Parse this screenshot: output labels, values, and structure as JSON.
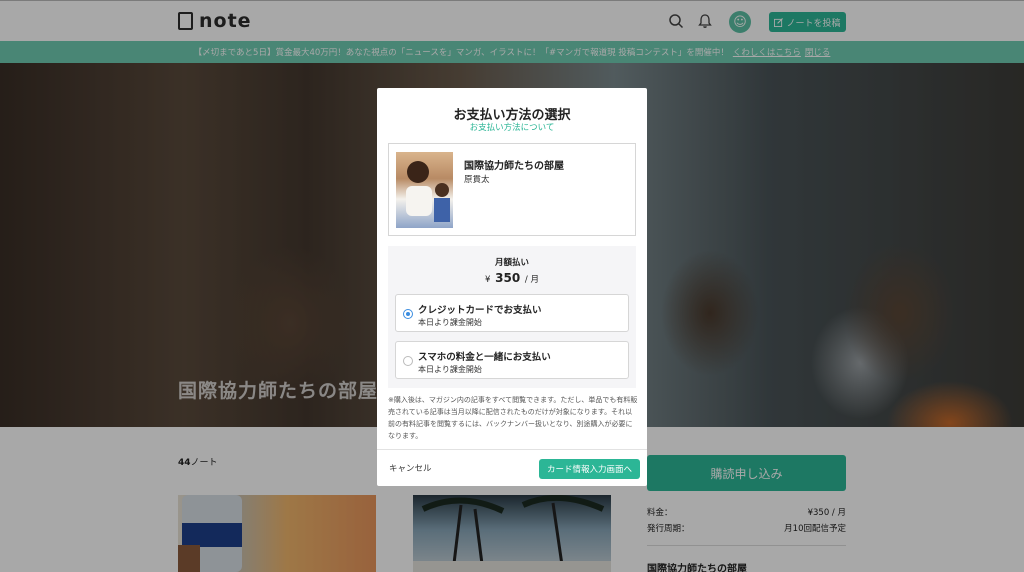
{
  "header": {
    "logo_text": "note",
    "post_button_label": "ノートを投稿",
    "avatar_glyph": "☺"
  },
  "banner": {
    "text": "【〆切まであと5日】賞金最大40万円！あなた視点の「ニュースを」マンガ、イラストに！「#マンガで報道現 投稿コンテスト」を開催中！",
    "details_link": "くわしくはこちら",
    "close_link": "閉じる"
  },
  "hero": {
    "title": "国際協力師たちの部屋"
  },
  "content": {
    "note_count": "44",
    "note_count_suffix": "ノート"
  },
  "sidebar": {
    "subscribe_button": "購読申し込み",
    "fee_label": "料金：",
    "fee_value": "¥350 / 月",
    "period_label": "発行周期：",
    "period_value": "月10回配信予定",
    "magazine_title": "国際協力師たちの部屋"
  },
  "modal": {
    "title": "お支払い方法の選択",
    "about_link": "お支払い方法について",
    "magazine": {
      "title": "国際協力師たちの部屋",
      "author": "原貫太"
    },
    "plan": {
      "label": "月額払い",
      "currency": "¥",
      "amount": "350",
      "unit": "/ 月"
    },
    "options": [
      {
        "title": "クレジットカードでお支払い",
        "subtitle": "本日より課金開始",
        "selected": true
      },
      {
        "title": "スマホの料金と一緒にお支払い",
        "subtitle": "本日より課金開始",
        "selected": false
      }
    ],
    "notice": "※購入後は、マガジン内の記事をすべて閲覧できます。ただし、単品でも有料販売されている記事は当月以降に配信されたものだけが対象になります。それ以前の有料記事を閲覧するには、バックナンバー扱いとなり、別途購入が必要になります。",
    "cancel_label": "キャンセル",
    "next_label": "カード情報入力画面へ"
  },
  "colors": {
    "accent": "#2cb696",
    "banner": "#6fcbb2",
    "radio_selected": "#3b8de0"
  }
}
